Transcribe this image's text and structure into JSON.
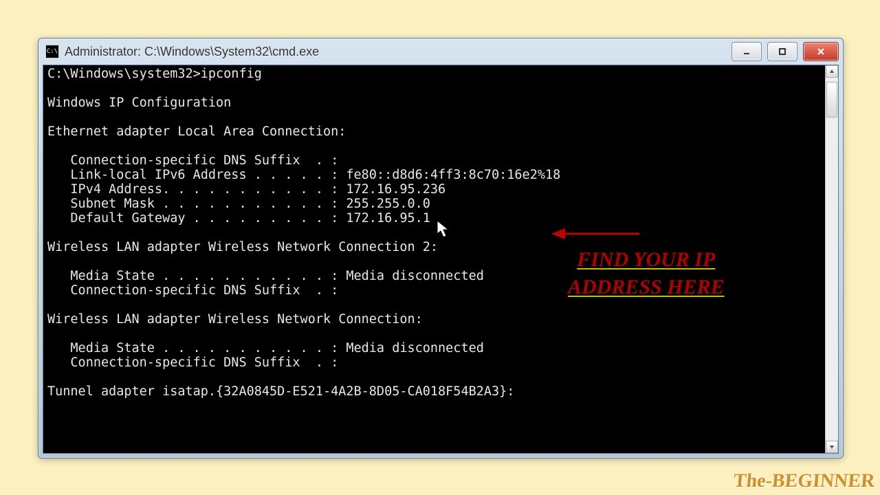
{
  "window": {
    "title": "Administrator: C:\\Windows\\System32\\cmd.exe",
    "icon_glyph": "C:\\"
  },
  "terminal": {
    "prompt_path": "C:\\Windows\\system32>",
    "command": "ipconfig",
    "header": "Windows IP Configuration",
    "adapters": [
      {
        "title": "Ethernet adapter Local Area Connection:",
        "rows": [
          {
            "label": "Connection-specific DNS Suffix  . :",
            "value": ""
          },
          {
            "label": "Link-local IPv6 Address . . . . . :",
            "value": "fe80::d8d6:4ff3:8c70:16e2%18"
          },
          {
            "label": "IPv4 Address. . . . . . . . . . . :",
            "value": "172.16.95.236"
          },
          {
            "label": "Subnet Mask . . . . . . . . . . . :",
            "value": "255.255.0.0"
          },
          {
            "label": "Default Gateway . . . . . . . . . :",
            "value": "172.16.95.1"
          }
        ]
      },
      {
        "title": "Wireless LAN adapter Wireless Network Connection 2:",
        "rows": [
          {
            "label": "Media State . . . . . . . . . . . :",
            "value": "Media disconnected"
          },
          {
            "label": "Connection-specific DNS Suffix  . :",
            "value": ""
          }
        ]
      },
      {
        "title": "Wireless LAN adapter Wireless Network Connection:",
        "rows": [
          {
            "label": "Media State . . . . . . . . . . . :",
            "value": "Media disconnected"
          },
          {
            "label": "Connection-specific DNS Suffix  . :",
            "value": ""
          }
        ]
      }
    ],
    "trailing": "Tunnel adapter isatap.{32A0845D-E521-4A2B-8D05-CA018F54B2A3}:"
  },
  "annotation": {
    "line1": "FIND  YOUR  IP",
    "line2": "ADDRESS  HERE"
  },
  "watermark": "The-BEGINNER"
}
